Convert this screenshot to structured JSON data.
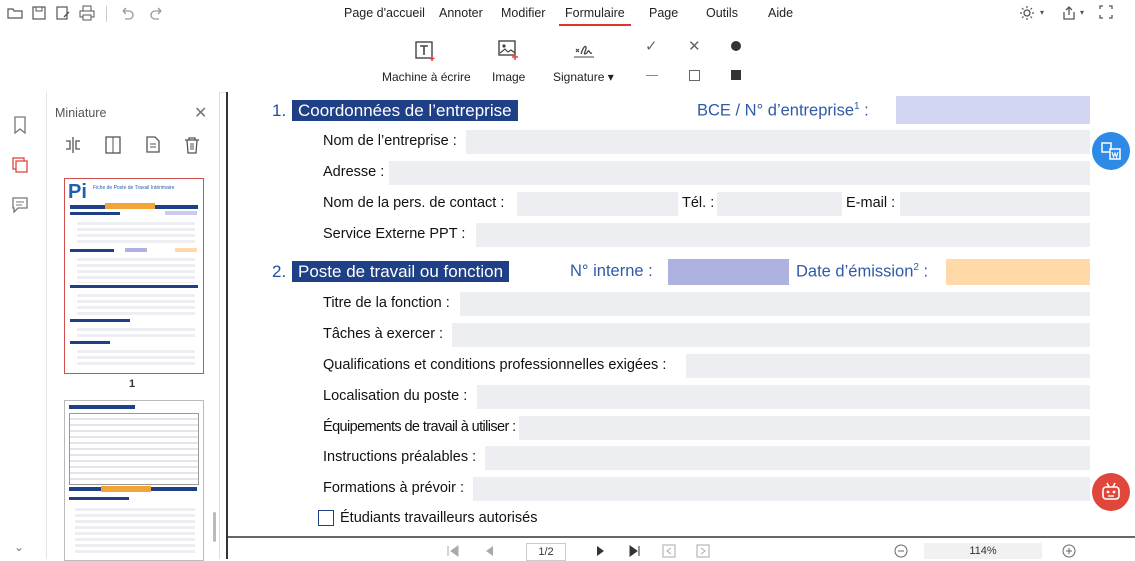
{
  "menu": {
    "items": [
      "Page d'accueil",
      "Annoter",
      "Modifier",
      "Formulaire",
      "Page",
      "Outils",
      "Aide"
    ],
    "active": "Formulaire"
  },
  "ribbon": {
    "typewriter": "Machine à écrire",
    "image": "Image",
    "signature": "Signature ▾"
  },
  "thumbnail_panel": {
    "title": "Miniature",
    "page1_number": "1",
    "thumb_title": "Fiche de Poste de Travail Intérimaire"
  },
  "document": {
    "section1": {
      "number": "1.",
      "title": "Coordonnées de l’entreprise",
      "bce_label": "BCE / N° d’entreprise",
      "bce_sup": "1",
      "bce_colon": ":",
      "fields": {
        "nom": "Nom de l’entreprise :",
        "adresse": "Adresse :",
        "contact": "Nom de la pers. de contact :",
        "tel": "Tél. :",
        "email": "E-mail :",
        "ppt": "Service Externe PPT :"
      }
    },
    "section2": {
      "number": "2.",
      "title": "Poste de travail ou fonction",
      "num_interne": "N° interne :",
      "date_label": "Date d’émission",
      "date_sup": "2",
      "date_colon": ":",
      "fields": {
        "titre": "Titre de la fonction :",
        "taches": "Tâches à exercer :",
        "qualif": "Qualifications et conditions professionnelles exigées :",
        "local": "Localisation du poste :",
        "equip": "Équipements de travail à utiliser :",
        "instr": "Instructions préalables :",
        "form": "Formations à prévoir :"
      },
      "checkbox_label": "Étudiants travailleurs autorisés"
    }
  },
  "status": {
    "page": "1/2",
    "zoom": "114%"
  },
  "colors": {
    "section_bg": "#1f3f86",
    "field_bg": "#eceef2",
    "bce_field": "#d3d6f2",
    "num_interne_field": "#aeb2e0",
    "date_field": "#ffd9a8",
    "accent_red": "#e0463c",
    "accent_blue": "#2d8ae6"
  }
}
